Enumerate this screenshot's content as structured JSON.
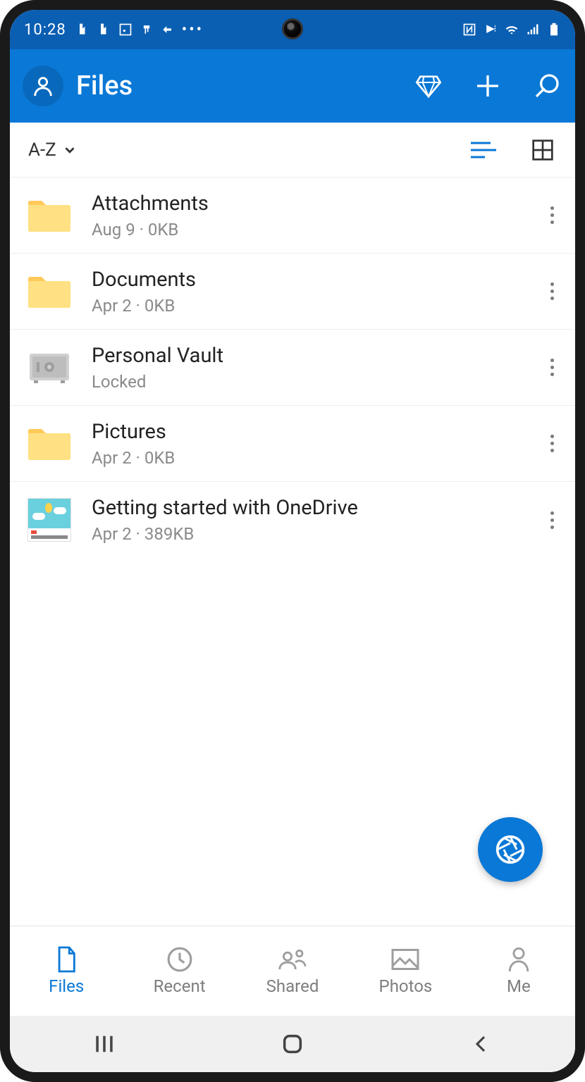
{
  "statusbar": {
    "time": "10:28"
  },
  "appbar": {
    "title": "Files"
  },
  "sort": {
    "label": "A-Z"
  },
  "items": [
    {
      "type": "folder",
      "name": "Attachments",
      "meta": "Aug 9 · 0KB"
    },
    {
      "type": "folder",
      "name": "Documents",
      "meta": "Apr 2 · 0KB"
    },
    {
      "type": "vault",
      "name": "Personal Vault",
      "meta": "Locked"
    },
    {
      "type": "folder",
      "name": "Pictures",
      "meta": "Apr 2 · 0KB"
    },
    {
      "type": "doc",
      "name": "Getting started with OneDrive",
      "meta": "Apr 2 · 389KB"
    }
  ],
  "tabs": {
    "files": "Files",
    "recent": "Recent",
    "shared": "Shared",
    "photos": "Photos",
    "me": "Me"
  }
}
